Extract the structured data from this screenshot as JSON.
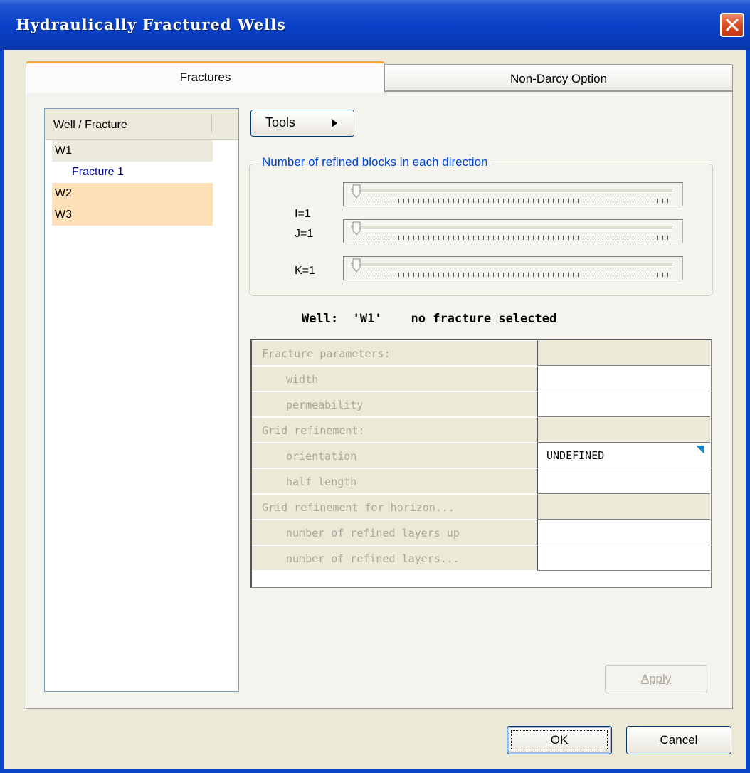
{
  "window": {
    "title": "Hydraulically Fractured Wells",
    "close_icon": "close-x-icon"
  },
  "tabs": [
    {
      "label": "Fractures",
      "active": true
    },
    {
      "label": "Non-Darcy Option",
      "active": false
    }
  ],
  "tree": {
    "header": "Well / Fracture",
    "items": [
      {
        "label": "W1",
        "level": 0
      },
      {
        "label": "Fracture 1",
        "level": 1
      },
      {
        "label": "W2",
        "level": 0
      },
      {
        "label": "W3",
        "level": 0
      }
    ]
  },
  "tools_button": {
    "label": "Tools",
    "icon": "arrow-right-icon"
  },
  "refinement": {
    "title": "Number of refined blocks in each direction",
    "sliders": [
      {
        "label": "I=1",
        "value": 1
      },
      {
        "label": "J=1",
        "value": 1
      },
      {
        "label": "K=1",
        "value": 1
      }
    ]
  },
  "status": {
    "text": "Well:  'W1'    no fracture selected"
  },
  "properties": [
    {
      "name": "Fracture parameters:",
      "category": true,
      "value": ""
    },
    {
      "name": "width",
      "category": false,
      "value": ""
    },
    {
      "name": "permeability",
      "category": false,
      "value": ""
    },
    {
      "name": "Grid refinement:",
      "category": true,
      "value": ""
    },
    {
      "name": "orientation",
      "category": false,
      "value": "UNDEFINED",
      "dropdown": true
    },
    {
      "name": "half length",
      "category": false,
      "value": ""
    },
    {
      "name": "Grid refinement for horizon...",
      "category": true,
      "value": ""
    },
    {
      "name": "number of refined layers up",
      "category": false,
      "value": ""
    },
    {
      "name": "number of refined layers...",
      "category": false,
      "value": ""
    }
  ],
  "buttons": {
    "apply": "Apply",
    "ok": "OK",
    "cancel": "Cancel"
  },
  "colors": {
    "titlebar": "#0a42c9",
    "tab_accent": "#f2a33a",
    "group_title": "#0046d5",
    "tree_highlight": "#fde0b8"
  }
}
